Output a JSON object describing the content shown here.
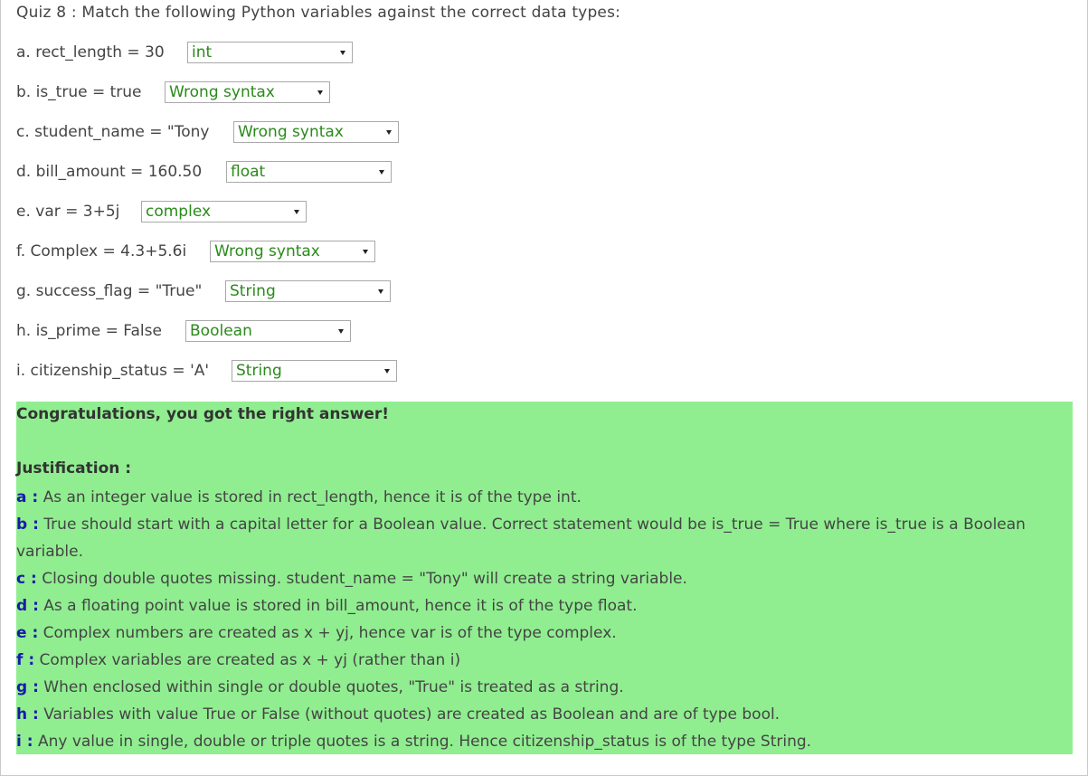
{
  "quiz": {
    "title": "Quiz 8 : Match the following Python variables against the correct data types:",
    "questions": [
      {
        "label": "a. rect_length = 30",
        "selected": "int"
      },
      {
        "label": "b. is_true = true",
        "selected": "Wrong syntax"
      },
      {
        "label": "c. student_name = \"Tony",
        "selected": "Wrong syntax"
      },
      {
        "label": "d. bill_amount = 160.50",
        "selected": "float"
      },
      {
        "label": "e. var = 3+5j",
        "selected": "complex"
      },
      {
        "label": "f. Complex = 4.3+5.6i",
        "selected": "Wrong syntax"
      },
      {
        "label": "g. success_flag = \"True\"",
        "selected": "String"
      },
      {
        "label": "h. is_prime = False",
        "selected": "Boolean"
      },
      {
        "label": "i. citizenship_status = 'A'",
        "selected": "String"
      }
    ]
  },
  "result": {
    "message": "Congratulations, you got the right answer!",
    "justification_title": "Justification :",
    "justifications": [
      {
        "key": "a :",
        "text": " As an integer value is stored in rect_length, hence it is of the type int."
      },
      {
        "key": "b :",
        "text": " True should start with a capital letter for a Boolean value. Correct statement would be is_true = True where is_true is a Boolean variable."
      },
      {
        "key": "c :",
        "text": " Closing double quotes missing. student_name = \"Tony\" will create a string variable."
      },
      {
        "key": "d :",
        "text": " As a floating point value is stored in bill_amount, hence it is of the type float."
      },
      {
        "key": "e :",
        "text": " Complex numbers are created as x + yj, hence var is of the type complex."
      },
      {
        "key": "f :",
        "text": " Complex variables are created as x + yj (rather than i)"
      },
      {
        "key": "g :",
        "text": " When enclosed within single or double quotes, \"True\" is treated as a string."
      },
      {
        "key": "h :",
        "text": " Variables with value True or False (without quotes) are created as Boolean and are of type bool."
      },
      {
        "key": "i :",
        "text": " Any value in single, double or triple quotes is a string. Hence citizenship_status is of the type String."
      }
    ]
  },
  "colors": {
    "result_bg": "#90ee90",
    "select_text": "#2a8a1a",
    "justification_key": "#1a1aa8"
  }
}
